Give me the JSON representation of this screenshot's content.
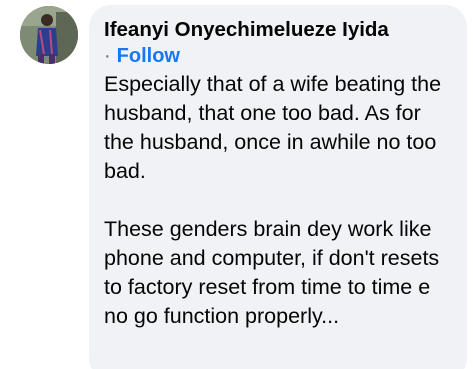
{
  "comment": {
    "author": "Ifeanyi Onyechimelueze Iyida",
    "separator": "·",
    "follow_label": "Follow",
    "paragraphs": [
      "Especially that of a wife beating the husband, that one too bad. As for the husband, once in awhile no too bad.",
      "These genders brain dey work like phone and computer, if don't resets to factory reset from time to time e no go function properly..."
    ]
  },
  "avatar": {
    "icon": "profile-photo"
  },
  "colors": {
    "bubble_bg": "#f0f2f5",
    "follow_link": "#1877f2",
    "text": "#050505"
  }
}
